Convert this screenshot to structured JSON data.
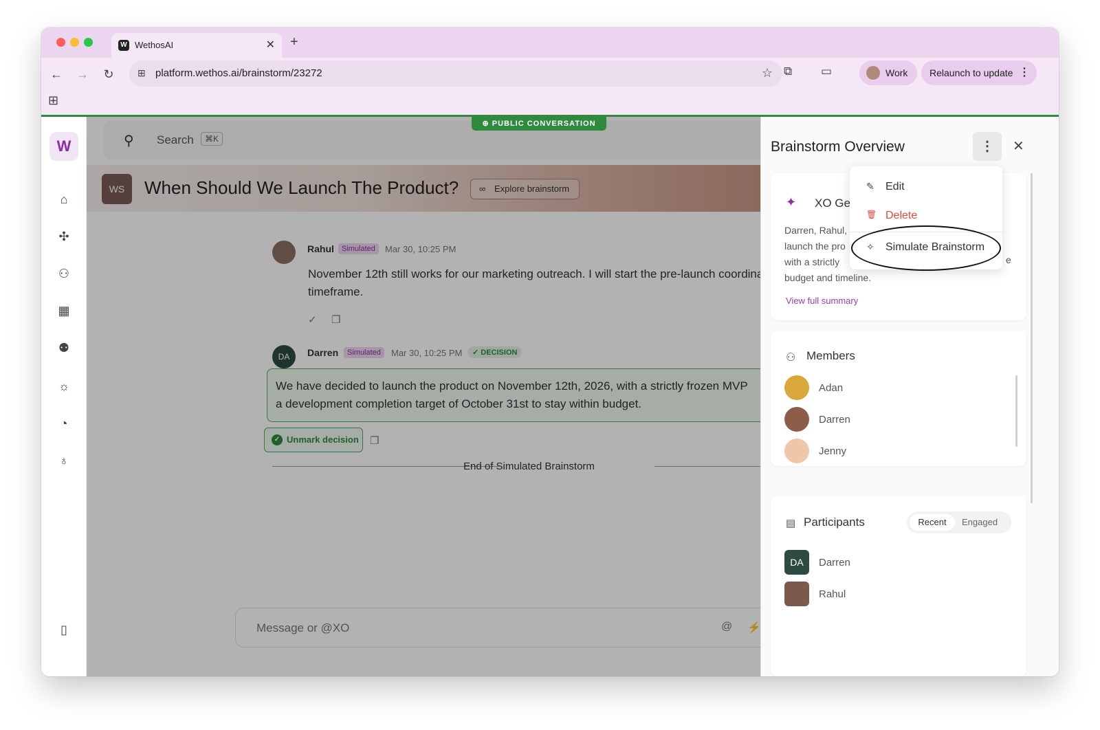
{
  "browser": {
    "tab_title": "WethosAI",
    "tab_favicon": "W",
    "url": "platform.wethos.ai/brainstorm/23272",
    "profile_label": "Work",
    "relaunch_label": "Relaunch to update"
  },
  "icons": {
    "back": "←",
    "forward": "→",
    "reload": "↻",
    "star": "☆",
    "extensions": "⧉",
    "cast": "▭",
    "apps": "⊞",
    "close": "✕",
    "plus": "+",
    "kebab": "⋮",
    "search": "⚲",
    "home": "⌂",
    "connect": "✣",
    "person": "⚇",
    "calendar": "▦",
    "team": "⚉",
    "bulb": "☼",
    "gauge": "◔",
    "mic": "♁",
    "sidebar_toggle": "▯",
    "link": "∞",
    "check": "✓",
    "copy": "❐",
    "at": "@",
    "bolt": "⚡",
    "sparkle": "✦",
    "pencil": "✎",
    "trash": "🗑",
    "wand": "✧",
    "members": "⚇",
    "chat": "▤",
    "globe": "⊕"
  },
  "app": {
    "logo": "W",
    "public_badge": "PUBLIC CONVERSATION",
    "search_placeholder": "Search",
    "search_shortcut": "⌘K",
    "workspace_initials": "WS",
    "title": "When Should We Launch The Product?",
    "explore_label": "Explore brainstorm",
    "messages": [
      {
        "author": "Rahul",
        "badge": "Simulated",
        "time": "Mar 30, 10:25 PM",
        "text": "November 12th still works for our marketing outreach. I will start the pre-launch coordination timeframe."
      },
      {
        "author": "Darren",
        "initials": "DA",
        "badge": "Simulated",
        "time": "Mar 30, 10:25 PM",
        "decision_label": "DECISION",
        "text": "We have decided to launch the product on November 12th, 2026, with a strictly frozen MVP a development completion target of October 31st to stay within budget."
      }
    ],
    "unmark_label": "Unmark decision",
    "end_label": "End of Simulated Brainstorm",
    "composer_placeholder": "Message or @XO"
  },
  "panel": {
    "title": "Brainstorm Overview",
    "summary_title": "XO Ge",
    "summary_lines": [
      "Darren, Rahul,",
      "launch the pro",
      "with a strictly",
      "budget and timeline."
    ],
    "summary_tail_char": "e",
    "view_summary": "View full summary",
    "members_title": "Members",
    "members": [
      "Adan",
      "Darren",
      "Jenny"
    ],
    "participants_title": "Participants",
    "segment": [
      "Recent",
      "Engaged"
    ],
    "participants": [
      {
        "name": "Darren",
        "initials": "DA"
      },
      {
        "name": "Rahul"
      }
    ]
  },
  "menu": {
    "edit": "Edit",
    "delete": "Delete",
    "simulate": "Simulate Brainstorm"
  },
  "colors": {
    "brand": "#8b2ea0",
    "decision_green": "#2f8a3e",
    "delete_red": "#e24b3b",
    "chrome_bg": "#f5e7f6"
  }
}
